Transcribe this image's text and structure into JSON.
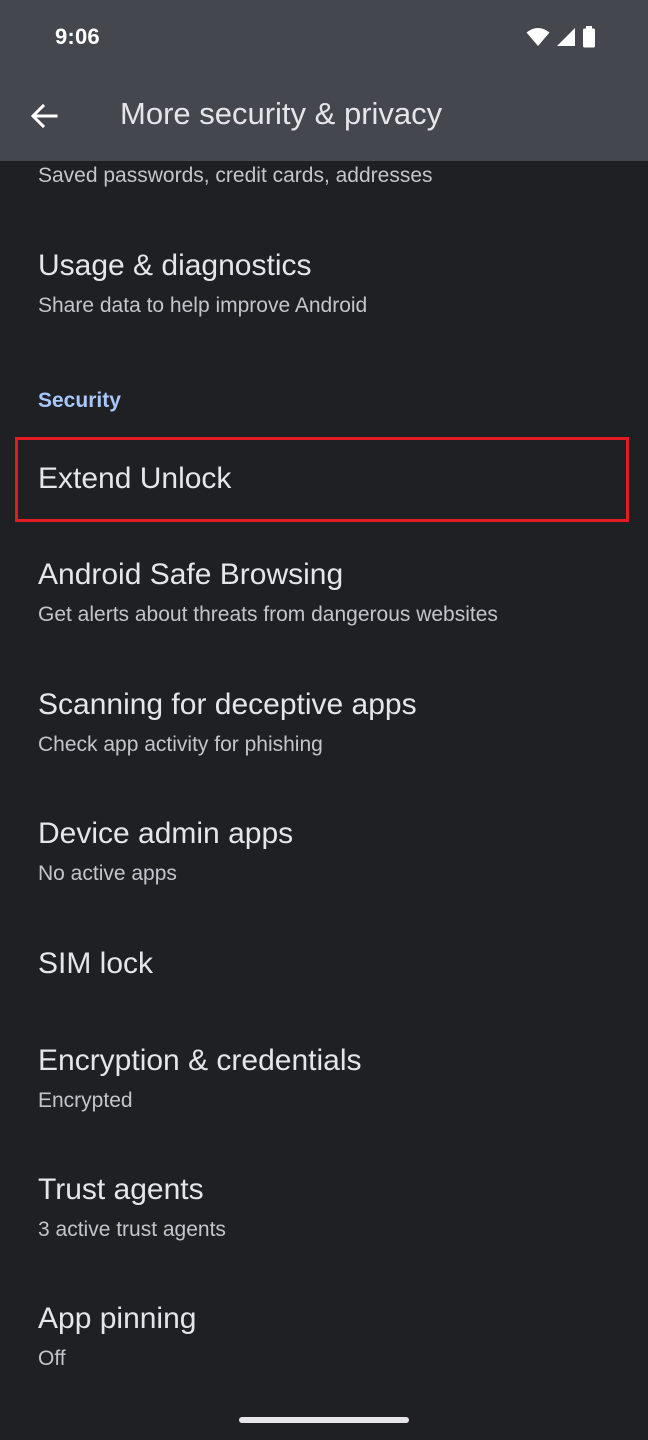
{
  "status_bar": {
    "time": "9:06",
    "icons": [
      "wifi-icon",
      "cell-signal-icon",
      "battery-icon"
    ]
  },
  "header": {
    "back_icon": "arrow-left-icon",
    "title": "More security & privacy"
  },
  "items": [
    {
      "id": "saved-info",
      "title": "",
      "subtitle": "Saved passwords, credit cards, addresses"
    },
    {
      "id": "usage-diagnostics",
      "title": "Usage & diagnostics",
      "subtitle": "Share data to help improve Android"
    }
  ],
  "security_section": {
    "header": "Security",
    "items": [
      {
        "id": "extend-unlock",
        "title": "Extend Unlock",
        "subtitle": ""
      },
      {
        "id": "safe-browsing",
        "title": "Android Safe Browsing",
        "subtitle": "Get alerts about threats from dangerous websites"
      },
      {
        "id": "deceptive-apps",
        "title": "Scanning for deceptive apps",
        "subtitle": "Check app activity for phishing"
      },
      {
        "id": "device-admin",
        "title": "Device admin apps",
        "subtitle": "No active apps"
      },
      {
        "id": "sim-lock",
        "title": "SIM lock",
        "subtitle": ""
      },
      {
        "id": "encryption",
        "title": "Encryption & credentials",
        "subtitle": "Encrypted"
      },
      {
        "id": "trust-agents",
        "title": "Trust agents",
        "subtitle": "3 active trust agents"
      },
      {
        "id": "app-pinning",
        "title": "App pinning",
        "subtitle": "Off"
      }
    ]
  },
  "colors": {
    "background": "#1f2024",
    "topbar": "#44474e",
    "section_header": "#a8c7fa",
    "highlight": "#e31b23"
  }
}
